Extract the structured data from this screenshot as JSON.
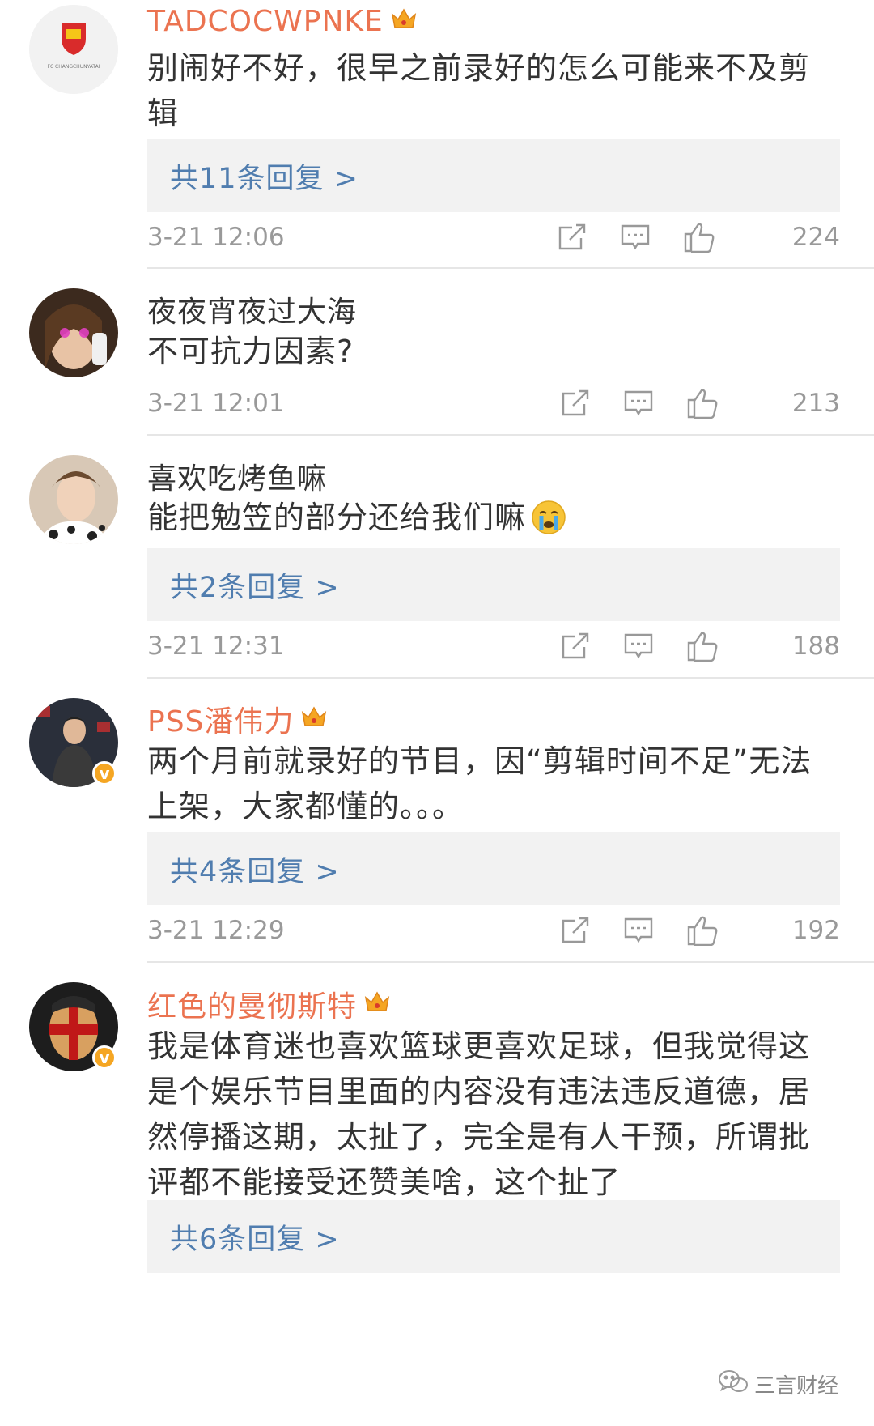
{
  "comments": [
    {
      "username": "TADCOCWPNKE",
      "text": "别闹好不好，很早之前录好的怎么可能来不及剪辑",
      "replies": "共11条回复 >",
      "time": "3-21 12:06",
      "likes": "224",
      "avatar_label": "FC CHANGCHUNYATAI",
      "vip": true
    },
    {
      "username": "夜夜宵夜过大海",
      "text": "不可抗力因素?",
      "time": "3-21 12:01",
      "likes": "213",
      "vip": false
    },
    {
      "username": "喜欢吃烤鱼嘛",
      "text": "能把勉笠的部分还给我们嘛",
      "emoji": "crying-face",
      "replies": "共2条回复 >",
      "time": "3-21 12:31",
      "likes": "188",
      "vip": false
    },
    {
      "username": "PSS潘伟力",
      "text": "两个月前就录好的节目，因“剪辑时间不足”无法上架，大家都懂的。。。",
      "replies": "共4条回复 >",
      "time": "3-21 12:29",
      "likes": "192",
      "vip": true,
      "verified": true
    },
    {
      "username": "红色的曼彻斯特",
      "text": "我是体育迷也喜欢篮球更喜欢足球，但我觉得这是个娱乐节目里面的内容没有违法违反道德，居然停播这期，太扯了，完全是有人干预，所谓批评都不能接受还赞美啥，这个扯了",
      "replies": "共6条回复 >",
      "vip": true,
      "verified": true
    }
  ],
  "badge": {
    "verified_mark": "v"
  },
  "watermark": {
    "text": "三言财经",
    "icon": "wechat-icon"
  },
  "colors": {
    "vip_name": "#eb7350",
    "reply_link": "#507daf",
    "meta": "#999999"
  }
}
